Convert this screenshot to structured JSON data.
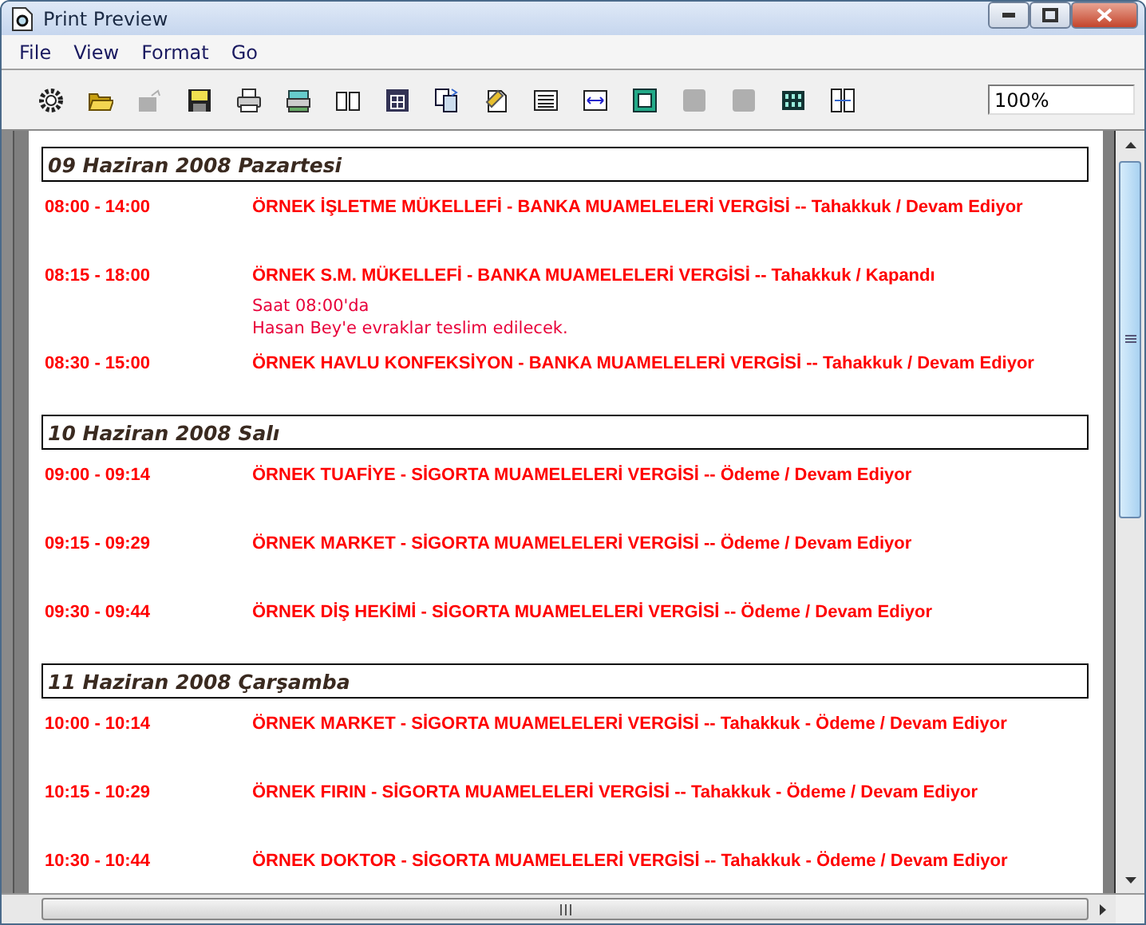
{
  "window": {
    "title": "Print Preview"
  },
  "menu": [
    "File",
    "View",
    "Format",
    "Go"
  ],
  "toolbar": [
    {
      "kind": "gear",
      "disabled": false
    },
    {
      "kind": "open",
      "disabled": false
    },
    {
      "kind": "export",
      "disabled": true
    },
    {
      "kind": "save",
      "disabled": false
    },
    {
      "kind": "print",
      "disabled": false
    },
    {
      "kind": "print-all",
      "disabled": false
    },
    {
      "kind": "book",
      "disabled": false
    },
    {
      "kind": "grid",
      "disabled": false
    },
    {
      "kind": "copy",
      "disabled": false
    },
    {
      "kind": "edit",
      "disabled": false
    },
    {
      "kind": "lines",
      "disabled": false
    },
    {
      "kind": "width",
      "disabled": false
    },
    {
      "kind": "frame",
      "disabled": false
    },
    {
      "kind": "blank",
      "disabled": true
    },
    {
      "kind": "blank",
      "disabled": true
    },
    {
      "kind": "multi",
      "disabled": false
    },
    {
      "kind": "fit",
      "disabled": false
    }
  ],
  "zoom": {
    "value": "100%"
  },
  "days": [
    {
      "date": "09 Haziran 2008 Pazartesi",
      "entries": [
        {
          "time": "08:00 - 14:00",
          "title": "ÖRNEK İŞLETME MÜKELLEFİ - BANKA MUAMELELERİ VERGİSİ -- Tahakkuk / Devam Ediyor"
        },
        {
          "time": "08:15 - 18:00",
          "title": "ÖRNEK S.M. MÜKELLEFİ - BANKA MUAMELELERİ VERGİSİ -- Tahakkuk / Kapandı",
          "notes": [
            "Saat 08:00'da",
            "Hasan Bey'e evraklar teslim edilecek."
          ]
        },
        {
          "time": "08:30 - 15:00",
          "title": "ÖRNEK HAVLU KONFEKSİYON - BANKA MUAMELELERİ VERGİSİ -- Tahakkuk / Devam Ediyor"
        }
      ]
    },
    {
      "date": "10 Haziran 2008 Salı",
      "entries": [
        {
          "time": "09:00 - 09:14",
          "title": "ÖRNEK TUAFİYE - SİGORTA MUAMELELERİ VERGİSİ -- Ödeme / Devam Ediyor"
        },
        {
          "time": "09:15 - 09:29",
          "title": "ÖRNEK MARKET - SİGORTA MUAMELELERİ VERGİSİ -- Ödeme / Devam Ediyor"
        },
        {
          "time": "09:30 - 09:44",
          "title": "ÖRNEK DİŞ HEKİMİ - SİGORTA MUAMELELERİ VERGİSİ -- Ödeme / Devam Ediyor"
        }
      ]
    },
    {
      "date": "11 Haziran 2008 Çarşamba",
      "entries": [
        {
          "time": "10:00 - 10:14",
          "title": "ÖRNEK MARKET - SİGORTA MUAMELELERİ VERGİSİ -- Tahakkuk - Ödeme / Devam Ediyor"
        },
        {
          "time": "10:15 - 10:29",
          "title": "ÖRNEK FIRIN - SİGORTA MUAMELELERİ VERGİSİ -- Tahakkuk - Ödeme / Devam Ediyor"
        },
        {
          "time": "10:30 - 10:44",
          "title": "ÖRNEK DOKTOR - SİGORTA MUAMELELERİ VERGİSİ -- Tahakkuk - Ödeme / Devam Ediyor"
        }
      ]
    }
  ]
}
